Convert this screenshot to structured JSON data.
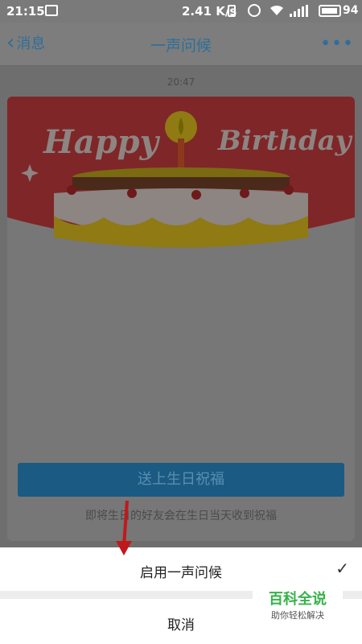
{
  "status_bar": {
    "time": "21:15",
    "speed": "2.41 K/s",
    "battery": "94",
    "battery_level": 0.94,
    "icons": [
      "image-icon",
      "vibrate-icon",
      "alarm-icon",
      "wifi-icon",
      "signal-icon",
      "battery-icon"
    ]
  },
  "nav": {
    "back_label": "消息",
    "title": "一声问候",
    "more_label": "•••"
  },
  "chat": {
    "timestamp": "20:47"
  },
  "card": {
    "banner_left": "Happy",
    "banner_right": "Birthday",
    "send_label": "送上生日祝福",
    "hint": "即将生日的好友会在生日当天收到祝福"
  },
  "sheet": {
    "enable_label": "启用一声问候",
    "enable_checked": true,
    "check_glyph": "✓",
    "cancel_label": "取消"
  },
  "watermark": {
    "title": "百科全说",
    "subtitle": "助你轻松解决"
  },
  "colors": {
    "accent": "#2e6f99",
    "banner_red": "#7f2628",
    "cake_yellow": "#8f7a14",
    "button_blue": "#1b5a82",
    "watermark_green": "#36b24a",
    "arrow_red": "#c0191c"
  }
}
